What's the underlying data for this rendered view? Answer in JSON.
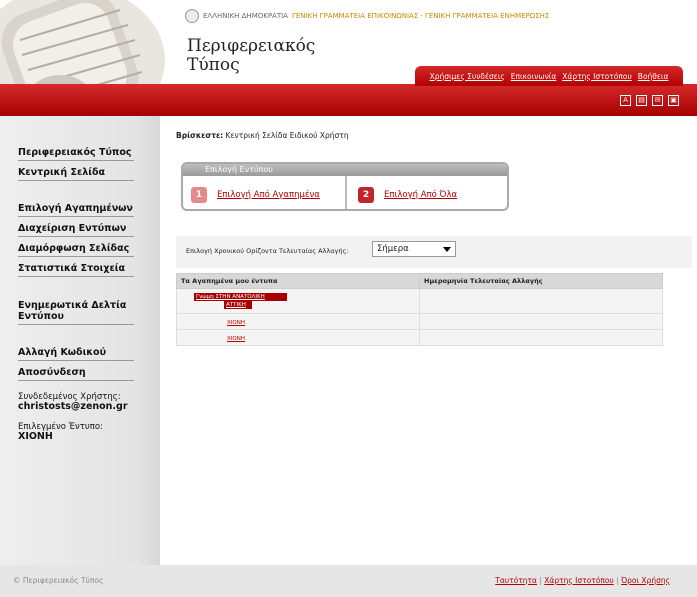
{
  "header": {
    "gov_text": "ΕΛΛΗΝΙΚΗ ΔΗΜΟΚΡΑΤΙΑ",
    "gov_links": "ΓΕΝΙΚΗ ΓΡΑΜΜΑΤΕΙΑ ΕΠΙΚΟΙΝΩΝΙΑΣ · ΓΕΝΙΚΗ ΓΡΑΜΜΑΤΕΙΑ ΕΝΗΜΕΡΩΣΗΣ",
    "site_title_line1": "Περιφερειακός",
    "site_title_line2": "Τύπος",
    "nav": [
      "Χρήσιμες Συνδέσεις",
      "Επικοινωνία",
      "Χάρτης Ιστοτόπου",
      "Βοήθεια"
    ],
    "tools": [
      "font-icon",
      "print-icon",
      "mail-icon",
      "save-icon"
    ]
  },
  "sidebar": {
    "items": [
      "Περιφερειακός Τύπος",
      "Κεντρική Σελίδα",
      "Επιλογή Αγαπημένων",
      "Διαχείριση Εντύπων",
      "Διαμόρφωση Σελίδας",
      "Στατιστικά Στοιχεία",
      "Ενημερωτικά Δελτία Εντύπου",
      "Αλλαγή Κωδικού",
      "Αποσύνδεση"
    ],
    "user_label": "Συνδεδεμένος Χρήστης:",
    "user_value": "christosts@zenon.gr",
    "selected_label": "Επιλεγμένο Έντυπο:",
    "selected_value": "ΧΙΟΝΗ"
  },
  "main": {
    "breadcrumb_label": "Βρίσκεστε:",
    "breadcrumb_value": "Κεντρική Σελίδα Ειδικού Χρήστη",
    "selection_box_title": "Επιλογή Εντύπου",
    "option1_num": "1",
    "option1_label": "Επιλογή Από Αγαπημένα",
    "option2_num": "2",
    "option2_label": "Επιλογή Από Όλα",
    "filter_label": "Επιλογή Χρονικού Ορίζοντα Τελευταίας Αλλαγής:",
    "filter_value": "Σήμερα",
    "table_headers": [
      "Τα Αγαπημένα μου έντυπα",
      "Ημερομηνία Τελευταίας Αλλαγής"
    ],
    "rows": [
      {
        "title_line1": "Γνώμη ΣΤΗΝ ΑΝΑΤΟΛΙΚΗ",
        "title_line2": "ΑΤΤΙΚΗ",
        "date": ""
      },
      {
        "title": "ΧΙΟΝΗ",
        "date": ""
      },
      {
        "title": "ΧΙΟΝΗ",
        "date": ""
      }
    ]
  },
  "footer": {
    "copyright": "© Περιφερειακός Τύπος",
    "links": [
      "Ταυτότητα",
      "Χάρτης Ιστοτόπου",
      "Όροι Χρήσης"
    ]
  }
}
